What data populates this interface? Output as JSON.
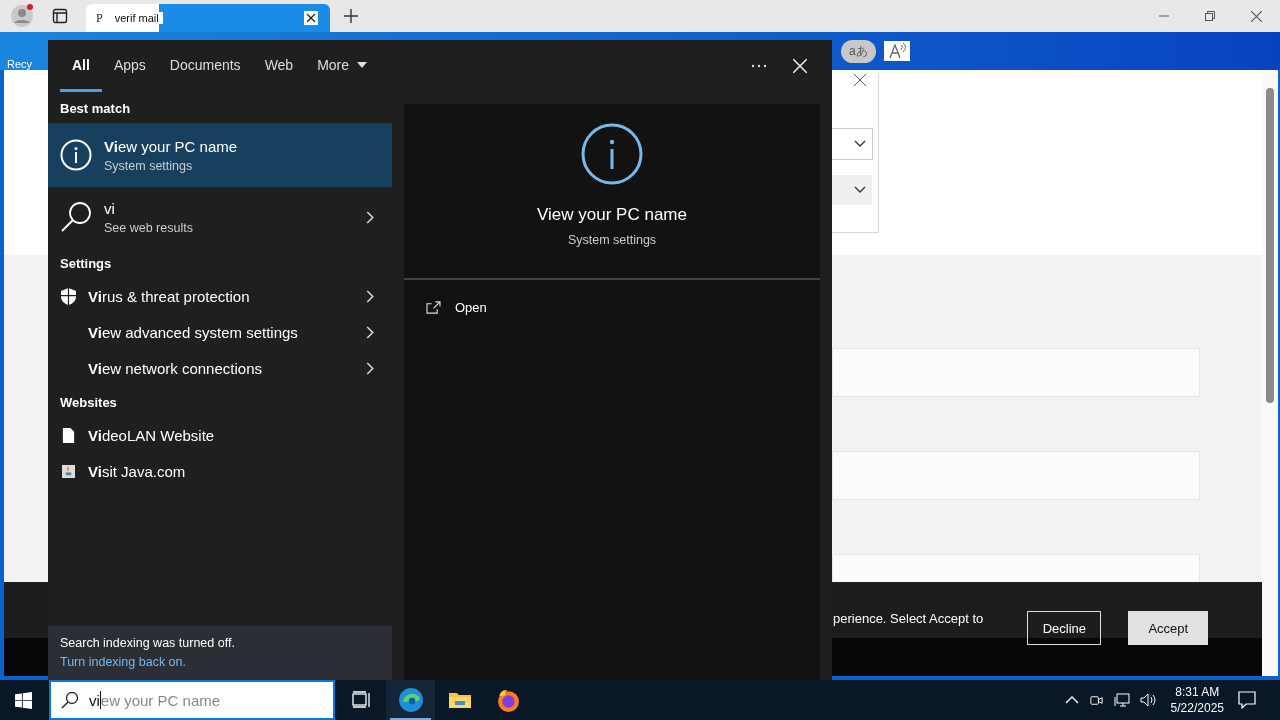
{
  "browser": {
    "tab": {
      "favicon": "P",
      "title": "verif mail"
    }
  },
  "desktop": {
    "label": "Recy"
  },
  "page": {
    "translate_button": "aあ",
    "cookie_text": "perience. Select Accept to",
    "cookie_buttons": [
      {
        "label": "Decline",
        "kind": "outline"
      },
      {
        "label": "Accept",
        "kind": "filled"
      }
    ]
  },
  "search_panel": {
    "tabs": [
      {
        "label": "All",
        "selected": true
      },
      {
        "label": "Apps",
        "selected": false
      },
      {
        "label": "Documents",
        "selected": false
      },
      {
        "label": "Web",
        "selected": false
      },
      {
        "label": "More",
        "selected": false
      }
    ],
    "sections": [
      {
        "heading": "Best match",
        "items": [
          {
            "kind": "best",
            "title": "**Vi**ew your PC name",
            "subtitle": "System settings",
            "selected": true
          },
          {
            "kind": "web",
            "title": "vi",
            "subtitle": "See web results",
            "selected": false
          }
        ]
      },
      {
        "heading": "Settings",
        "items": [
          {
            "kind": "defender",
            "title": "**Vi**rus & threat protection",
            "selected": false
          },
          {
            "kind": "setting",
            "title": "**Vi**ew advanced system settings",
            "selected": false
          },
          {
            "kind": "setting",
            "title": "**Vi**ew network connections",
            "selected": false
          }
        ]
      },
      {
        "heading": "Websites",
        "items": [
          {
            "kind": "website",
            "title": "**Vi**deoLAN Website",
            "selected": false
          },
          {
            "kind": "java",
            "title": "**Vi**sit Java.com",
            "selected": false
          }
        ]
      }
    ],
    "preview": {
      "title": "View your PC name",
      "subtitle": "System settings",
      "actions": [
        "Open"
      ]
    },
    "notice": {
      "text": "Search indexing was turned off.",
      "link": "Turn indexing back on."
    }
  },
  "taskbar": {
    "search": {
      "value": "vi",
      "suggestion": "ew your PC name"
    },
    "apps": [
      {
        "kind": "taskview",
        "active": false
      },
      {
        "kind": "edge",
        "active": true
      },
      {
        "kind": "explorer",
        "active": false
      },
      {
        "kind": "firefox",
        "active": false
      }
    ],
    "time": "8:31 AM",
    "date": "5/22/2025"
  }
}
